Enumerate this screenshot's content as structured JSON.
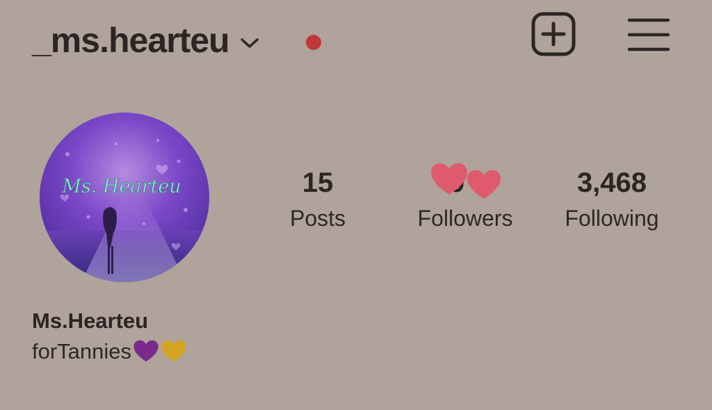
{
  "header": {
    "username": "_ms.hearteu",
    "notification_dot_color": "#c0393a",
    "icons": [
      "chevron-down-icon",
      "plus-square-icon",
      "hamburger-menu-icon"
    ]
  },
  "avatar": {
    "text": "Ms. Hearteu"
  },
  "stats": {
    "posts": {
      "value": "15",
      "label": "Posts"
    },
    "followers": {
      "value_visible": "9",
      "label": "Followers"
    },
    "following": {
      "value": "3,468",
      "label": "Following"
    }
  },
  "bio": {
    "display_name": "Ms.Hearteu",
    "text": "forTannies",
    "emoji": [
      "purple-heart-icon",
      "yellow-heart-icon"
    ]
  },
  "colors": {
    "background": "#afa39b",
    "text": "#2c2523",
    "sticker_heart": "#e05a6d",
    "purple_heart": "#7a2a8c",
    "yellow_heart": "#d4a321"
  }
}
